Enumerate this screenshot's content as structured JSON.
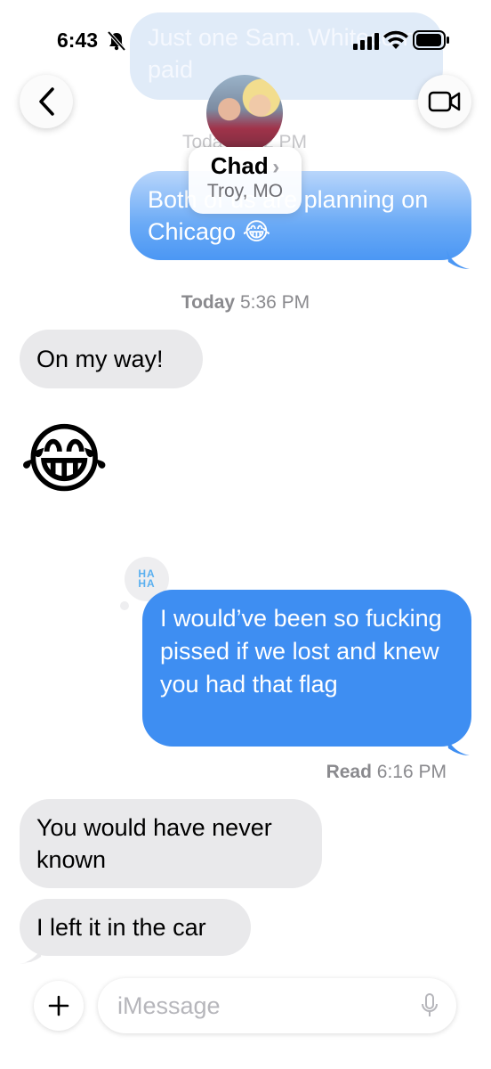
{
  "status_bar": {
    "time": "6:43"
  },
  "header": {
    "contact_name": "Chad",
    "contact_chevron": "›",
    "contact_location": "Troy, MO",
    "avatar_icon": "contact-photo",
    "back_icon": "chevron-left",
    "video_icon": "video-camera"
  },
  "messages": {
    "faded_top_text": "Just one Sam. Whitecorn paid",
    "faded_stamp": "Today 5:22 PM",
    "sent_1": "Both of us are planning on Chicago 😂",
    "stamp_1_day": "Today",
    "stamp_1_time": "5:36 PM",
    "received_1": "On my way!",
    "received_emoji": "😂",
    "tapback": "HA HA",
    "sent_2": "I would’ve been so fucking pissed if we lost and knew you had that flag",
    "read_label": "Read",
    "read_time": "6:16 PM",
    "received_2": "You would have never known",
    "received_3": "I left it in the car"
  },
  "composer": {
    "plus_icon": "plus",
    "placeholder": "iMessage",
    "mic_icon": "microphone"
  },
  "colors": {
    "sent_bubble": "#3e8ef2",
    "received_bubble": "#e9e9eb",
    "timestamp": "#8a8a8e"
  }
}
